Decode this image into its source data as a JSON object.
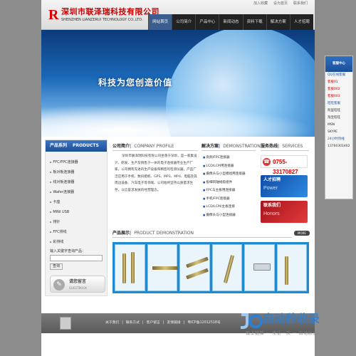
{
  "header": {
    "logo_mark": "R",
    "company_cn": "深圳市联泽瑞科技有限公司",
    "company_en": "SHENZHEN LIANZERUI TECHNOLOGY CO.,LTD.",
    "toplinks": [
      "加入收藏",
      "设为首页",
      "联系我们"
    ]
  },
  "nav": {
    "items": [
      "网站首页",
      "公司简介",
      "产品中心",
      "新闻动态",
      "资料下载",
      "解决方案",
      "人才招聘"
    ]
  },
  "banner": {
    "slogan": "科技为您创造价值"
  },
  "sidebar": {
    "title_cn": "产品系列",
    "title_en": "PRODUCTS",
    "items": [
      "FFC/FPC连接器",
      "板对板连接器",
      "线对板连接器",
      "Wafer连接器",
      "卡座",
      "MINI USB",
      "排针",
      "FFC排线",
      "彩排线"
    ],
    "keyword_label": "输入关键字查询产品：",
    "search_btn": "查询",
    "guestbook_cn": "请您留言",
    "guestbook_en": "GUESTBOOK"
  },
  "company": {
    "title_cn": "公司简介",
    "title_en": "COMPANY PROFILE",
    "text": "深圳市联泽瑞科技有限公司坐落于深圳，是一家集设计、研发、生产及销售于一体的电子连接器专业生产厂家。公司拥有先进的生产设备和精密的检测仪器，产品广泛应用于手机、数码相机、GPS、MP3、MP4、电脑及其周边设备、汽车电子等领域。公司始终坚持以质量求生存，以信誉求发展的经营理念。"
  },
  "solutions": {
    "title_cn": "解决方案",
    "title_en": "DEMONSTRATION",
    "items": [
      "高频/FPC连接器",
      "LCD/LCM用连接器",
      "摄像头与小型模组用连接器",
      "极细同轴线缆组件",
      "FPC与主板用连接器",
      "手机/FPC连接器",
      "LCD/LCM/主板连接",
      "摄像头与小型连接器"
    ]
  },
  "service": {
    "title_cn": "服务热线",
    "title_en": "SERVICES",
    "phone": "0755-33170827",
    "promo1_cn": "人才招聘",
    "promo1_en": "Power",
    "promo2_cn": "联系我们",
    "promo2_en": "Honors"
  },
  "products": {
    "title_cn": "产品展示",
    "title_en": "PRODUCT DEMONSTRATION",
    "more": "MORE"
  },
  "footer": {
    "links": [
      "关于我们",
      "联系方式",
      "客户留言",
      "友情链接",
      "粤ICP备12012518号"
    ]
  },
  "float_panel": {
    "title": "客服中心",
    "rows": [
      "QQ在线客服",
      "客服01",
      "客服002",
      "客服003",
      "旺旺客服",
      "阿里旺旺",
      "淘宝旺旺",
      "MSN",
      "SKYPE",
      "24小时热线",
      "13760301462"
    ]
  },
  "watermark": {
    "title": "自动秒收录",
    "sub": "做上链接 一 来访一次 一 自动收录"
  },
  "colors": {
    "accent": "#2b5fa8",
    "brand_red": "#cc0000",
    "nav_dark": "#222222"
  }
}
